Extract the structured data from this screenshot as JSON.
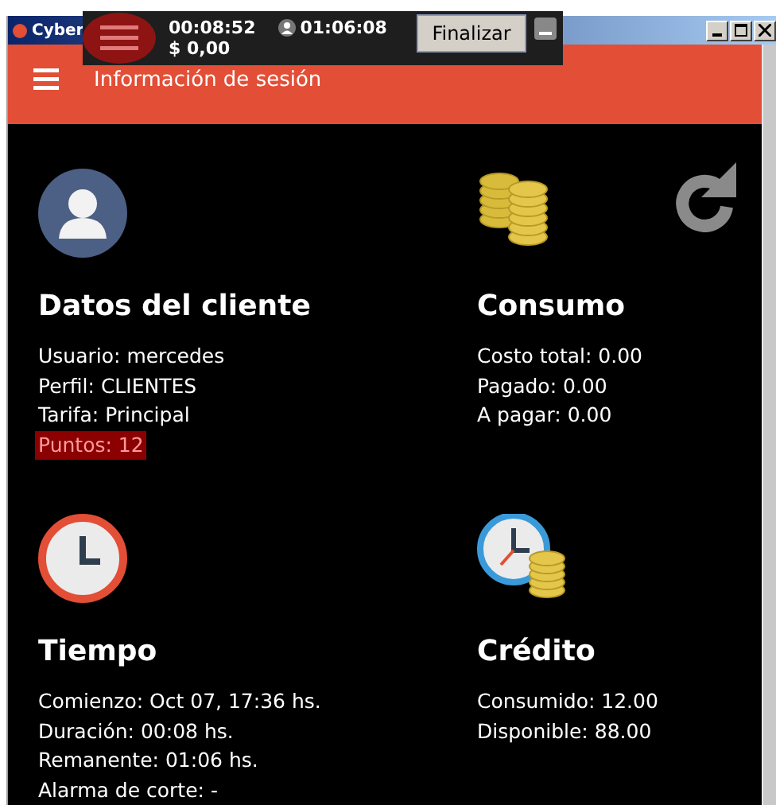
{
  "window": {
    "title": "Cyber"
  },
  "overlay": {
    "elapsed": "00:08:52",
    "remaining": "01:06:08",
    "amount": "$ 0,00",
    "button": "Finalizar"
  },
  "header": {
    "title": "Información de sesión"
  },
  "cards": [
    {
      "kind": "user",
      "title": "Datos del cliente",
      "lines": [
        {
          "text": "Usuario: mercedes",
          "highlighted": false
        },
        {
          "text": "Perfil: CLIENTES",
          "highlighted": false
        },
        {
          "text": "Tarifa: Principal",
          "highlighted": false
        },
        {
          "text": "Puntos: 12",
          "highlighted": true
        }
      ]
    },
    {
      "kind": "coins",
      "title": "Consumo",
      "lines": [
        {
          "text": "Costo total: 0.00",
          "highlighted": false
        },
        {
          "text": "Pagado: 0.00",
          "highlighted": false
        },
        {
          "text": "A pagar: 0.00",
          "highlighted": false
        }
      ]
    },
    {
      "kind": "clock",
      "title": "Tiempo",
      "lines": [
        {
          "text": "Comienzo: Oct 07, 17:36 hs.",
          "highlighted": false
        },
        {
          "text": "Duración: 00:08 hs.",
          "highlighted": false
        },
        {
          "text": "Remanente: 01:06 hs.",
          "highlighted": false
        },
        {
          "text": "Alarma de corte: -",
          "highlighted": false
        }
      ]
    },
    {
      "kind": "credit",
      "title": "Crédito",
      "lines": [
        {
          "text": "Consumido: 12.00",
          "highlighted": false
        },
        {
          "text": "Disponible: 88.00",
          "highlighted": false
        }
      ]
    }
  ]
}
